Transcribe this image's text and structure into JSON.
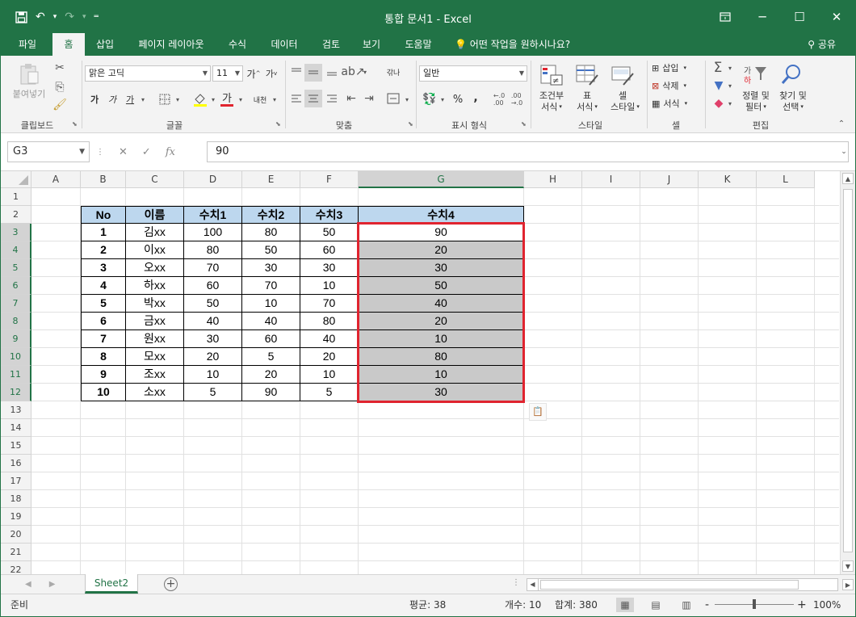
{
  "title": "통합 문서1 - Excel",
  "window": {
    "ribbon_display_icon": "ribbon-display-icon",
    "minimize": "─",
    "restore": "☐",
    "close": "✕"
  },
  "qat": {
    "save_icon": "save-icon",
    "undo_icon": "undo-icon",
    "redo_icon": "redo-icon",
    "customize_icon": "customize-qat-icon"
  },
  "tabs": [
    "파일",
    "홈",
    "삽입",
    "페이지 레이아웃",
    "수식",
    "데이터",
    "검토",
    "보기",
    "도움말"
  ],
  "tell_me": "어떤 작업을 원하시나요?",
  "share": "공유",
  "ribbon": {
    "clipboard": {
      "paste": "붙여넣기",
      "label": "클립보드"
    },
    "font": {
      "font_name": "맑은 고딕",
      "font_size": "11",
      "bold": "가",
      "italic": "가",
      "underline": "가",
      "label": "글꼴",
      "phonetic": "내천"
    },
    "alignment": {
      "label": "맞춤",
      "wrap": "갂나"
    },
    "number": {
      "format": "일반",
      "percent": "%",
      "comma": ",",
      "label": "표시 형식"
    },
    "styles": {
      "conditional": "조건부\n서식",
      "table": "표\n서식",
      "cell_styles": "셀\n스타일",
      "label": "스타일",
      "conditional_l1": "조건부",
      "conditional_l2": "서식",
      "table_l1": "표",
      "table_l2": "서식",
      "cell_l1": "셀",
      "cell_l2": "스타일"
    },
    "cells": {
      "insert": "삽입",
      "delete": "삭제",
      "format": "서식",
      "label": "셀"
    },
    "editing": {
      "sort_l1": "정렬 및",
      "sort_l2": "필터",
      "find_l1": "찾기 및",
      "find_l2": "선택",
      "label": "편집"
    }
  },
  "formula_bar": {
    "name_box": "G3",
    "fx": "fx",
    "value": "90"
  },
  "columns": [
    "A",
    "B",
    "C",
    "D",
    "E",
    "F",
    "G",
    "H",
    "I",
    "J",
    "K",
    "L"
  ],
  "rows": [
    "1",
    "2",
    "3",
    "4",
    "5",
    "6",
    "7",
    "8",
    "9",
    "10",
    "11",
    "12",
    "13",
    "14",
    "15",
    "16",
    "17",
    "18",
    "19",
    "20",
    "21",
    "22"
  ],
  "table": {
    "headers": [
      "No",
      "이름",
      "수치1",
      "수치2",
      "수치3",
      "수치4"
    ],
    "rows": [
      [
        "1",
        "김xx",
        "100",
        "80",
        "50",
        "90"
      ],
      [
        "2",
        "이xx",
        "80",
        "50",
        "60",
        "20"
      ],
      [
        "3",
        "오xx",
        "70",
        "30",
        "30",
        "30"
      ],
      [
        "4",
        "하xx",
        "60",
        "70",
        "10",
        "50"
      ],
      [
        "5",
        "박xx",
        "50",
        "10",
        "70",
        "40"
      ],
      [
        "6",
        "금xx",
        "40",
        "40",
        "80",
        "20"
      ],
      [
        "7",
        "원xx",
        "30",
        "60",
        "40",
        "10"
      ],
      [
        "8",
        "모xx",
        "20",
        "5",
        "20",
        "80"
      ],
      [
        "9",
        "조xx",
        "10",
        "20",
        "10",
        "10"
      ],
      [
        "10",
        "소xx",
        "5",
        "90",
        "5",
        "30"
      ]
    ]
  },
  "sheet": {
    "name": "Sheet2",
    "add": "+"
  },
  "status": {
    "ready": "준비",
    "average": "평균: 38",
    "count": "개수: 10",
    "sum": "합계: 380",
    "zoom_minus": "-",
    "zoom_plus": "+",
    "zoom": "100%"
  },
  "colors": {
    "excel_green": "#217346",
    "header_fill": "#bdd7ee",
    "selection_fill": "#c9c9c9",
    "highlight_border": "#e0242f"
  }
}
